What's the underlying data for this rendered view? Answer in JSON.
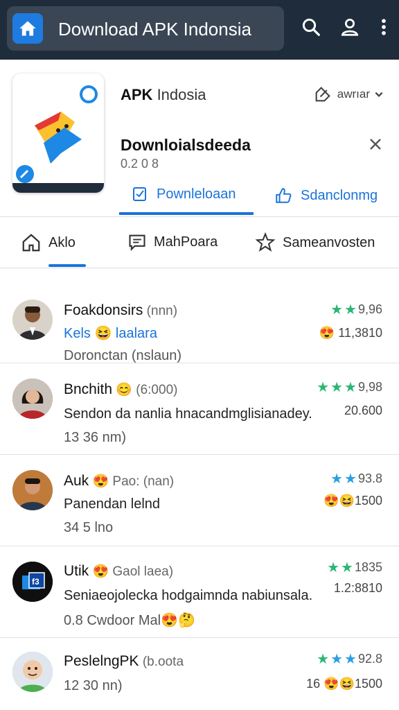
{
  "header": {
    "title": "Download APK Indonsia",
    "home_icon": "home-icon",
    "icons": [
      "search-icon",
      "user-icon",
      "more-vertical-icon"
    ]
  },
  "app": {
    "name_bold": "APK",
    "name_rest": " Indosia",
    "share_label": "awrıar",
    "download_title": "Downloialsdeeda",
    "download_sub": "0.2 0 8",
    "tabs": [
      {
        "label": "Pownleloaan",
        "icon": "checkbox-icon"
      },
      {
        "label": "Sdanclonmg",
        "icon": "thumbs-up-icon"
      }
    ]
  },
  "nav": {
    "tabs": [
      {
        "label": "Aklo",
        "icon": "home-outline-icon"
      },
      {
        "label": "MahPoara",
        "icon": "message-icon"
      },
      {
        "label": "Sameanvosten",
        "icon": "star-chat-icon"
      }
    ]
  },
  "reviews": [
    {
      "name": "Foakdonsirs",
      "meta": " (nnn)",
      "line1": "Kels 😆 laalara",
      "line2": "Doronctan (nslaun)",
      "rating": "9,96",
      "count": "11,3810",
      "count_emoji": "😍"
    },
    {
      "name": "Bnchith",
      "meta": " 😊 (6:000)",
      "line1": "Sendon da nanlia hnacandmglisianadey.",
      "line2": "13 36 nm)",
      "rating": "9,98",
      "count": "20.600",
      "count_emoji": ""
    },
    {
      "name": "Auk",
      "meta": " 😍 Pao: (nan)",
      "line1": "Panendan lelnd",
      "line2": "34 5 lno",
      "rating": "93.8",
      "count": "1500",
      "count_emoji": "😍😆"
    },
    {
      "name": "Utik",
      "meta": " 😍 Gaol laea)",
      "line1": "Seniaeojolecka hodgaimnda nabiunsala.",
      "line2": "0.8 Cwdoor Mal😍🤔",
      "rating": "1835",
      "count": "1.2:8810",
      "count_emoji": ""
    },
    {
      "name": "PeslelngPK",
      "meta": " (b.oota",
      "line1": "12 30 nn)",
      "line2": "",
      "rating": "92.8",
      "count": "16 😍😆1500",
      "count_emoji": ""
    }
  ],
  "colors": {
    "topbar": "#1f2c3b",
    "accent": "#1a73d9",
    "star_green": "#2bb673",
    "star_blue": "#2b9fe0"
  }
}
